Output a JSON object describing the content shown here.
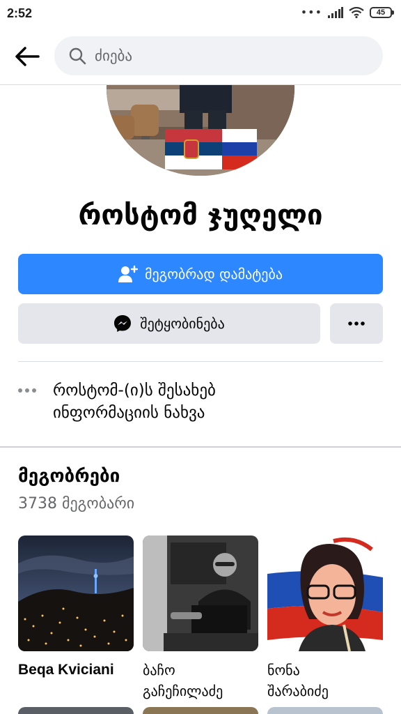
{
  "status_bar": {
    "time": "2:52",
    "dots": "•••",
    "battery": "45"
  },
  "search": {
    "placeholder": "ძიება"
  },
  "profile": {
    "name": "როსტომ ჯუღელი"
  },
  "actions": {
    "add_friend_label": "მეგობრად დამატება",
    "message_label": "შეტყობინება",
    "more_label": "•••"
  },
  "about": {
    "line1": "როსტომ-(ი)ს შესახებ",
    "line2": "ინფორმაციის ნახვა"
  },
  "friends": {
    "title": "მეგობრები",
    "count": "3738 მეგობარი",
    "items": [
      {
        "name_line1": "Beqa Kviciani",
        "name_line2": ""
      },
      {
        "name_line1": "ბაჩო",
        "name_line2": "გაჩეჩილაძე"
      },
      {
        "name_line1": "ნონა",
        "name_line2": "შარაბიძე"
      }
    ]
  },
  "colors": {
    "primary": "#2d88ff",
    "secondary_button": "#e4e6eb",
    "search_bg": "#f0f2f5",
    "muted_text": "#65676b"
  }
}
